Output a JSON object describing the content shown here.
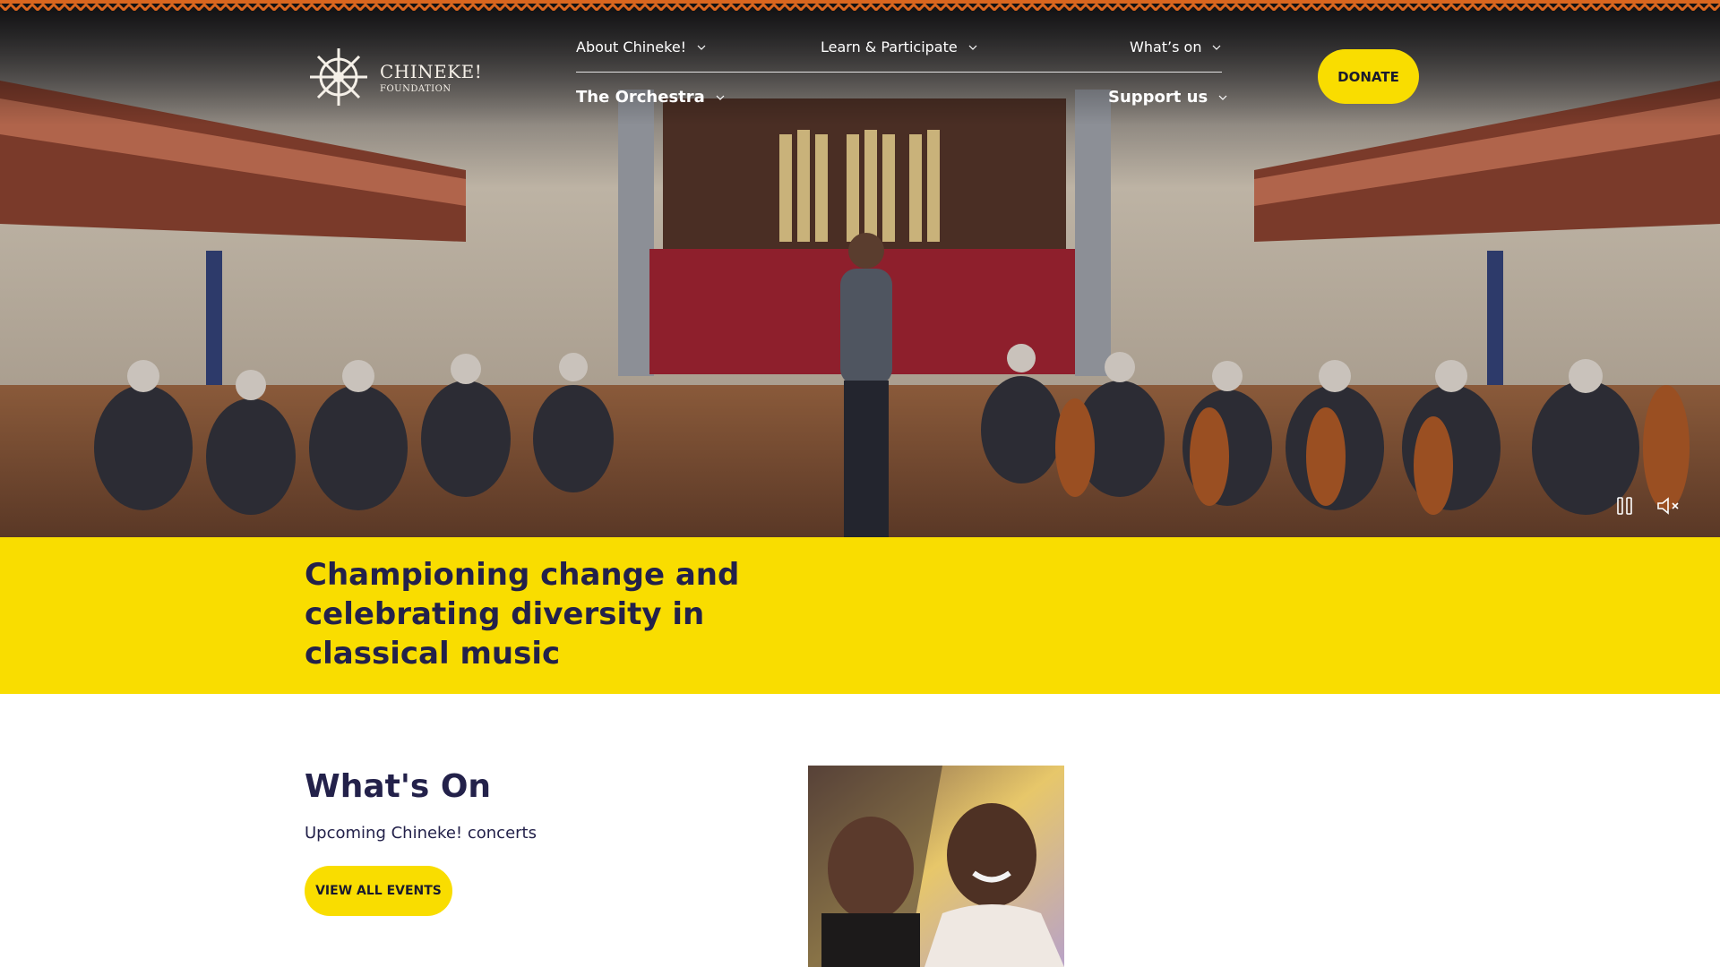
{
  "brand": {
    "name": "CHINEKE!",
    "subtitle": "FOUNDATION",
    "accent_yellow": "#f9dd00",
    "zigzag_color": "#d9661f",
    "text_navy": "#23214a"
  },
  "nav": {
    "top": [
      {
        "label": "About Chineke!"
      },
      {
        "label": "Learn & Participate"
      },
      {
        "label": "What’s on"
      }
    ],
    "bottom": [
      {
        "label": "The Orchestra"
      },
      {
        "label": "Support us"
      }
    ],
    "donate_label": "DONATE"
  },
  "hero": {
    "video_controls": [
      "pause-icon",
      "mute-icon"
    ],
    "tagline": "Championing change and celebrating diversity in classical music"
  },
  "whats_on": {
    "title": "What's On",
    "subtitle": "Upcoming Chineke! concerts",
    "button_label": "VIEW ALL EVENTS"
  }
}
